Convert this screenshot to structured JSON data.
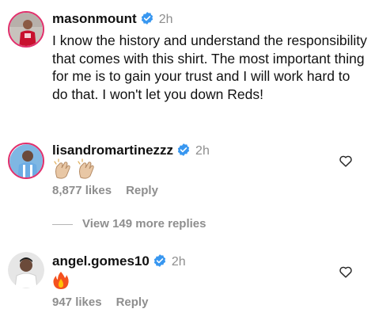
{
  "post": {
    "username": "masonmount",
    "time": "2h",
    "caption": "I know the history and understand the responsibility that comes with this shirt. The most important thing for me is to gain your trust and I will work hard to do that. I won't let you down Reds!"
  },
  "comments": [
    {
      "username": "lisandromartinezzz",
      "time": "2h",
      "emoji_text": "👏🏻👏🏻",
      "likes": "8,877 likes",
      "reply_label": "Reply"
    },
    {
      "username": "angel.gomes10",
      "time": "2h",
      "emoji_text": "🔥",
      "likes": "947 likes",
      "reply_label": "Reply"
    }
  ],
  "view_replies_label": "View 149 more replies",
  "colors": {
    "verified_blue": "#3897f0",
    "muted_gray": "#8e8e8e",
    "text": "#111111"
  },
  "icons": {
    "verified": "verified-badge-icon",
    "like": "heart-outline-icon",
    "fire": "fire-emoji",
    "clap": "clapping-hands-emoji"
  }
}
